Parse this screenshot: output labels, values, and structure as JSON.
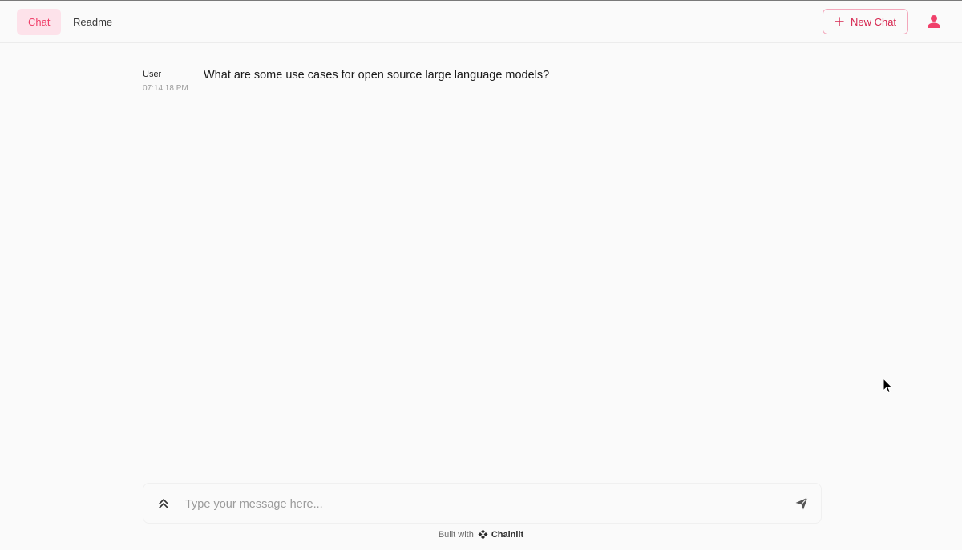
{
  "header": {
    "tabs": [
      {
        "label": "Chat",
        "active": true
      },
      {
        "label": "Readme",
        "active": false
      }
    ],
    "new_chat_label": "New Chat",
    "user_icon": "user-icon"
  },
  "messages": [
    {
      "author": "User",
      "time": "07:14:18 PM",
      "content": "What are some use cases for open source large language models?"
    }
  ],
  "composer": {
    "placeholder": "Type your message here...",
    "value": ""
  },
  "footer": {
    "built_with": "Built with",
    "brand": "Chainlit"
  },
  "colors": {
    "accent": "#f0406a",
    "accent_dark": "#d6264f",
    "active_tab_bg": "#fde2ea",
    "background": "#fafafa"
  }
}
